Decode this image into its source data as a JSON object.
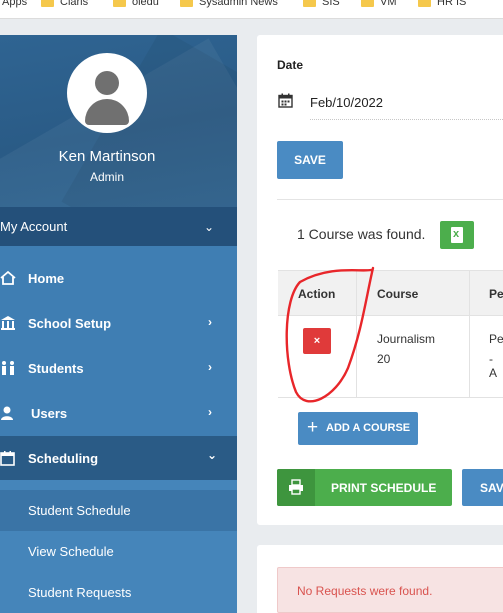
{
  "bookmarks": [
    {
      "label": "Apps"
    },
    {
      "label": "Claris"
    },
    {
      "label": "oledu"
    },
    {
      "label": "Sysadmin News"
    },
    {
      "label": "SIS"
    },
    {
      "label": "VM"
    },
    {
      "label": "HR IS"
    }
  ],
  "sidebar": {
    "user_name": "Ken Martinson",
    "user_role": "Admin",
    "my_account_label": "My Account",
    "items": [
      {
        "label": "Home",
        "icon": "home-icon"
      },
      {
        "label": "School Setup",
        "icon": "building-icon"
      },
      {
        "label": "Students",
        "icon": "students-icon"
      },
      {
        "label": "Users",
        "icon": "users-icon"
      },
      {
        "label": "Scheduling",
        "icon": "calendar-icon"
      }
    ],
    "sub_items": [
      {
        "label": "Student Schedule"
      },
      {
        "label": "View Schedule"
      },
      {
        "label": "Student Requests"
      }
    ]
  },
  "form": {
    "date_label": "Date",
    "date_value": "Feb/10/2022",
    "save_label": "SAVE"
  },
  "courses": {
    "found_text": "1 Course was found.",
    "excel_icon": "excel-icon",
    "columns": [
      "Action",
      "Course",
      "Pe"
    ],
    "rows": [
      {
        "course_line1": "Journalism",
        "course_line2": "20",
        "period_line1": "Pe",
        "period_line2": "- A"
      }
    ],
    "delete_label": "×",
    "add_label": "ADD A COURSE"
  },
  "actions": {
    "print_label": "PRINT SCHEDULE",
    "save2_label": "SAV"
  },
  "requests": {
    "empty_text": "No Requests were found."
  },
  "colors": {
    "primary_blue": "#4a8bc3",
    "success_green": "#4cae4c",
    "danger_red": "#e03a3a",
    "sidebar_blue": "#3f7eb3",
    "annotation_red": "#e8262a"
  }
}
